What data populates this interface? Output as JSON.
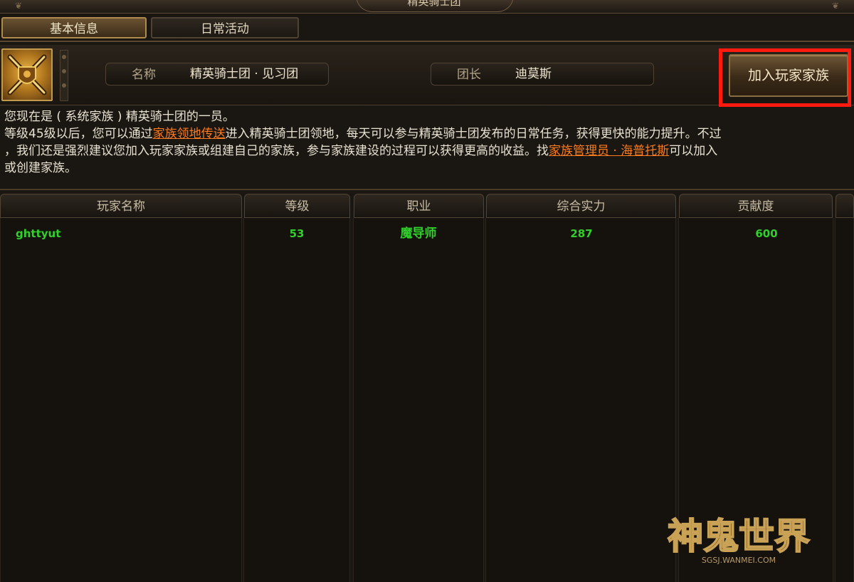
{
  "window": {
    "title": "精英骑士团"
  },
  "tabs": [
    {
      "label": "基本信息",
      "active": true
    },
    {
      "label": "日常活动",
      "active": false
    }
  ],
  "guild": {
    "emblem_icon": "crossed-swords-shield-icon",
    "name_label": "名称",
    "name_value": "精英骑士团 · 见习团",
    "leader_label": "团长",
    "leader_value": "迪莫斯",
    "join_button": "加入玩家家族"
  },
  "info": {
    "line1": "您现在是 ( 系统家族 ) 精英骑士团的一员。",
    "line2_a": "等级45级以后，您可以通过",
    "line2_link": "家族领地传送",
    "line2_b": "进入精英骑士团领地，每天可以参与精英骑士团发布的日常任务，获得更快的能力提升。不过",
    "line3_a": "，我们还是强烈建议您加入玩家家族或组建自己的家族，参与家族建设的过程可以获得更高的收益。找",
    "line3_link": "家族管理员 · 海普托斯",
    "line3_b": "可以加入",
    "line4": "或创建家族。"
  },
  "table": {
    "headers": [
      "玩家名称",
      "等级",
      "职业",
      "综合实力",
      "贡献度"
    ],
    "rows": [
      {
        "name": "ghttyut",
        "level": "53",
        "class": "魔导师",
        "power": "287",
        "contribution": "600"
      }
    ]
  },
  "logo": {
    "title": "神鬼世界",
    "subtitle": "SGSJ.WANMEI.COM"
  },
  "colors": {
    "highlight": "#ff1a10",
    "link": "#ff7a1a",
    "row_text": "#2fd12a"
  }
}
